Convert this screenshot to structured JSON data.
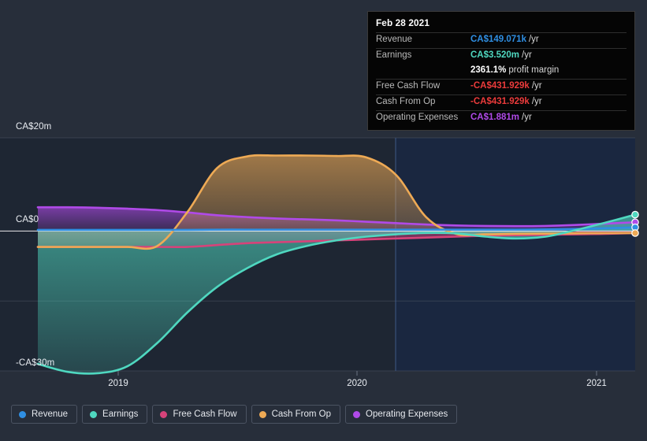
{
  "chart_data": {
    "type": "area",
    "title": "",
    "xlabel": "",
    "ylabel": "",
    "currency": "CA$",
    "grid": true,
    "legend_position": "bottom-left",
    "ylim": [
      -30,
      20
    ],
    "y_ticks": [
      {
        "value": 20,
        "label": "CA$20m"
      },
      {
        "value": 0,
        "label": "CA$0"
      },
      {
        "value": -30,
        "label": "-CA$30m"
      }
    ],
    "x_ticks": [
      {
        "value": 2019,
        "label": "2019"
      },
      {
        "value": 2020,
        "label": "2020"
      },
      {
        "value": 2021,
        "label": "2021"
      }
    ],
    "x_range": [
      "2018.67",
      "2021.50"
    ],
    "forecast_divider_x": 2020.17,
    "series": [
      {
        "name": "Revenue",
        "color": "#2f8fe3",
        "values": [
          0.25,
          0.25,
          0.25,
          0.25,
          0.25,
          0.25,
          0.3,
          0.3,
          0.3,
          0.3,
          0.3,
          0.3,
          0.3,
          0.3,
          0.3,
          0.3,
          0.3,
          0.35,
          0.45,
          0.6,
          0.8
        ]
      },
      {
        "name": "Earnings",
        "color": "#4fd8c0",
        "values": [
          -28.5,
          -30.2,
          -30.5,
          -29.0,
          -24.0,
          -17.5,
          -12.0,
          -8.0,
          -5.0,
          -3.2,
          -2.0,
          -1.2,
          -0.7,
          -0.4,
          -0.5,
          -1.2,
          -1.6,
          -1.2,
          0.2,
          1.8,
          3.52
        ]
      },
      {
        "name": "Free Cash Flow",
        "color": "#d6437a",
        "values": [
          -3.4,
          -3.4,
          -3.4,
          -3.4,
          -3.4,
          -3.4,
          -3.0,
          -2.6,
          -2.4,
          -2.2,
          -2.0,
          -1.8,
          -1.6,
          -1.4,
          -1.2,
          -1.0,
          -0.9,
          -0.8,
          -0.7,
          -0.6,
          -0.43
        ]
      },
      {
        "name": "Cash From Op",
        "color": "#eeaa55",
        "values": [
          -3.4,
          -3.4,
          -3.4,
          -3.4,
          -3.2,
          4.0,
          13.5,
          16.0,
          16.2,
          16.2,
          16.1,
          15.8,
          12.0,
          3.0,
          -0.6,
          -0.7,
          -0.6,
          -0.55,
          -0.5,
          -0.46,
          -0.43
        ]
      },
      {
        "name": "Operating Expenses",
        "color": "#b04ae8",
        "values": [
          5.1,
          5.1,
          5.0,
          4.8,
          4.5,
          4.0,
          3.4,
          3.0,
          2.7,
          2.5,
          2.3,
          2.0,
          1.7,
          1.4,
          1.2,
          1.1,
          1.05,
          1.1,
          1.3,
          1.6,
          1.881
        ]
      }
    ]
  },
  "tooltip": {
    "date": "Feb 28 2021",
    "rows": [
      {
        "key": "Revenue",
        "value": "CA$149.071k",
        "unit": "/yr",
        "color": "#2f8fe3"
      },
      {
        "key": "Earnings",
        "value": "CA$3.520m",
        "unit": "/yr",
        "color": "#4fd8c0"
      },
      {
        "key": "",
        "value": "2361.1%",
        "unit": "profit margin",
        "color": "#ffffff"
      },
      {
        "key": "Free Cash Flow",
        "value": "-CA$431.929k",
        "unit": "/yr",
        "color": "#ec3b3b"
      },
      {
        "key": "Cash From Op",
        "value": "-CA$431.929k",
        "unit": "/yr",
        "color": "#ec3b3b"
      },
      {
        "key": "Operating Expenses",
        "value": "CA$1.881m",
        "unit": "/yr",
        "color": "#b04ae8"
      }
    ]
  },
  "legend": {
    "items": [
      {
        "label": "Revenue",
        "color": "#2f8fe3"
      },
      {
        "label": "Earnings",
        "color": "#4fd8c0"
      },
      {
        "label": "Free Cash Flow",
        "color": "#d6437a"
      },
      {
        "label": "Cash From Op",
        "color": "#eeaa55"
      },
      {
        "label": "Operating Expenses",
        "color": "#b04ae8"
      }
    ]
  },
  "axis": {
    "y_top": "CA$20m",
    "y_zero": "CA$0",
    "y_bottom": "-CA$30m",
    "x_2019": "2019",
    "x_2020": "2020",
    "x_2021": "2021"
  },
  "colors": {
    "background": "#272e3a",
    "plot_past": "#1e2633",
    "plot_future": "#1a2740",
    "gridline": "#4d5563",
    "zero_line": "#ffffff"
  }
}
